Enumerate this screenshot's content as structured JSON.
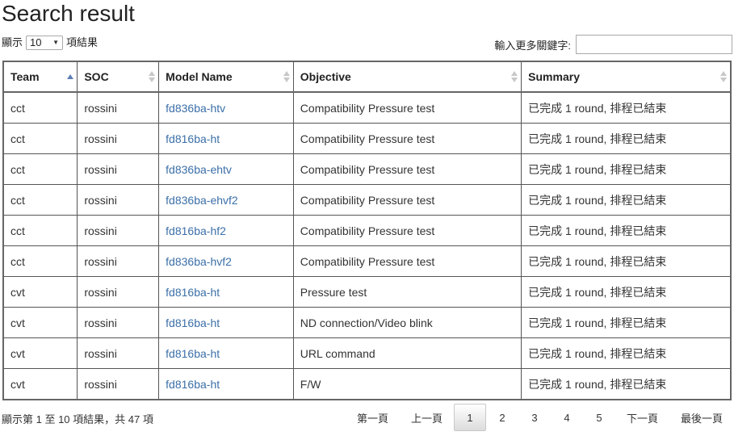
{
  "title": "Search result",
  "length_control": {
    "prefix": "顯示",
    "value": "10",
    "suffix": "項結果"
  },
  "filter": {
    "label": "輸入更多關鍵字:",
    "value": ""
  },
  "table": {
    "columns": [
      "Team",
      "SOC",
      "Model Name",
      "Objective",
      "Summary"
    ],
    "rows": [
      [
        "cct",
        "rossini",
        "fd836ba-htv",
        "Compatibility Pressure test",
        "已完成 1 round, 排程已結束"
      ],
      [
        "cct",
        "rossini",
        "fd816ba-ht",
        "Compatibility Pressure test",
        "已完成 1 round, 排程已結束"
      ],
      [
        "cct",
        "rossini",
        "fd836ba-ehtv",
        "Compatibility Pressure test",
        "已完成 1 round, 排程已結束"
      ],
      [
        "cct",
        "rossini",
        "fd836ba-ehvf2",
        "Compatibility Pressure test",
        "已完成 1 round, 排程已結束"
      ],
      [
        "cct",
        "rossini",
        "fd816ba-hf2",
        "Compatibility Pressure test",
        "已完成 1 round, 排程已結束"
      ],
      [
        "cct",
        "rossini",
        "fd836ba-hvf2",
        "Compatibility Pressure test",
        "已完成 1 round, 排程已結束"
      ],
      [
        "cvt",
        "rossini",
        "fd816ba-ht",
        "Pressure test",
        "已完成 1 round, 排程已結束"
      ],
      [
        "cvt",
        "rossini",
        "fd816ba-ht",
        "ND connection/Video blink",
        "已完成 1 round, 排程已結束"
      ],
      [
        "cvt",
        "rossini",
        "fd816ba-ht",
        "URL command",
        "已完成 1 round, 排程已結束"
      ],
      [
        "cvt",
        "rossini",
        "fd816ba-ht",
        "F/W",
        "已完成 1 round, 排程已結束"
      ]
    ]
  },
  "info": "顯示第 1 至 10 項結果，共 47 項",
  "pagination": {
    "first": "第一頁",
    "previous": "上一頁",
    "pages": [
      "1",
      "2",
      "3",
      "4",
      "5"
    ],
    "current": "1",
    "next": "下一頁",
    "last": "最後一頁"
  }
}
